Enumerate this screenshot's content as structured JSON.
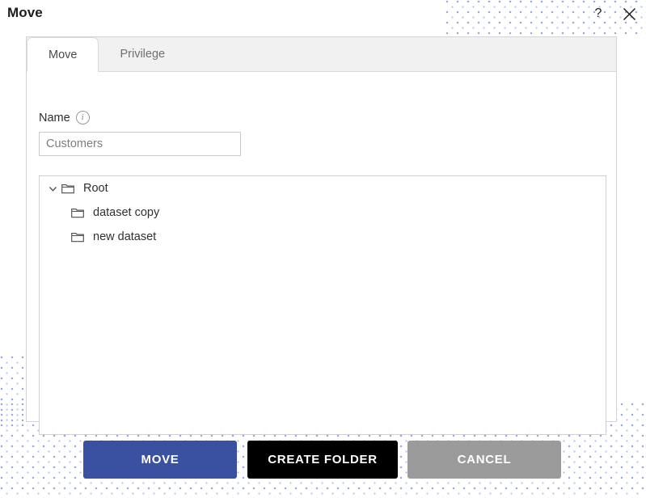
{
  "window": {
    "title": "Move",
    "help_icon": "question-mark-icon",
    "close_icon": "close-icon"
  },
  "tabs": [
    {
      "label": "Move",
      "active": true
    },
    {
      "label": "Privilege",
      "active": false
    }
  ],
  "form": {
    "name_label": "Name",
    "info_icon_glyph": "i",
    "name_value": "Customers",
    "name_placeholder": "Customers"
  },
  "tree": {
    "nodes": [
      {
        "label": "Root",
        "level": 0,
        "expanded": true,
        "icon": "folder-icon"
      },
      {
        "label": "dataset copy",
        "level": 1,
        "expanded": false,
        "icon": "folder-icon"
      },
      {
        "label": "new dataset",
        "level": 1,
        "expanded": false,
        "icon": "folder-icon"
      }
    ]
  },
  "footer": {
    "move_label": "MOVE",
    "create_folder_label": "CREATE FOLDER",
    "cancel_label": "CANCEL"
  },
  "colors": {
    "primary_blue": "#3a50a0",
    "black": "#000000",
    "gray": "#9b9b9b",
    "dot_pattern": "#9aa7e6",
    "tab_inactive_bg": "#f1f1f1"
  }
}
